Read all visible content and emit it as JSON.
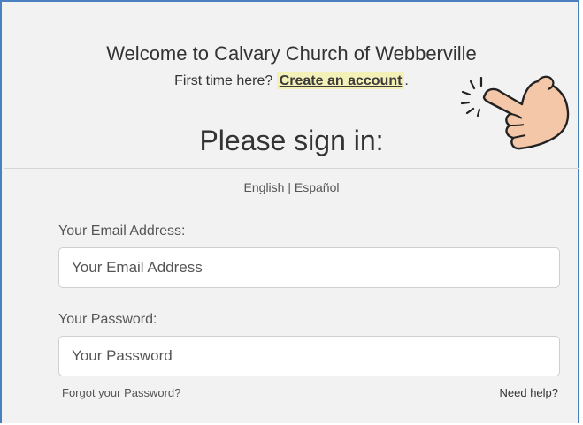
{
  "header": {
    "welcome": "Welcome to Calvary Church of Webberville",
    "first_time_prefix": "First time here? ",
    "create_account": "Create an account",
    "first_time_suffix": ".",
    "title": "Please sign in:"
  },
  "language": {
    "english": "English",
    "separator": " | ",
    "spanish": "Español"
  },
  "email": {
    "label": "Your Email Address:",
    "placeholder": "Your Email Address",
    "value": ""
  },
  "password": {
    "label": "Your Password:",
    "placeholder": "Your Password",
    "value": ""
  },
  "links": {
    "forgot": "Forgot your Password?",
    "help": "Need help?"
  },
  "colors": {
    "frame_border": "#4a7fc0",
    "link_highlight": "#f4f1b8",
    "hand_fill": "#f3c7a8"
  },
  "icons": {
    "pointer": "pointing-hand-icon"
  }
}
